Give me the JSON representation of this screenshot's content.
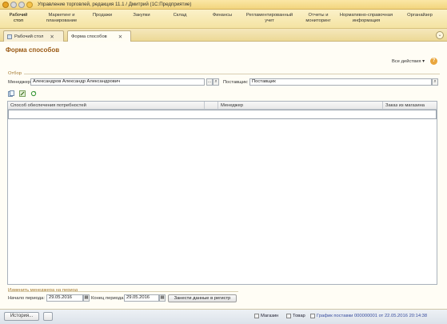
{
  "window": {
    "title": "Управление торговлей, редакция 11.1 / Дмитрий  (1С:Предприятие)"
  },
  "menu": [
    {
      "label": "Рабочий стол"
    },
    {
      "label": "Маркетинг и планирование"
    },
    {
      "label": "Продажи"
    },
    {
      "label": "Закупки"
    },
    {
      "label": "Склад"
    },
    {
      "label": "Финансы"
    },
    {
      "label": "Регламентированный учет"
    },
    {
      "label": "Отчеты и мониторинг"
    },
    {
      "label": "Нормативно-справочная информация"
    },
    {
      "label": "Органайзер"
    }
  ],
  "tabs": [
    {
      "label": "Рабочий стол"
    },
    {
      "label": "Форма способов"
    }
  ],
  "form": {
    "title": "Форма способов",
    "all_actions": "Все действия ▾",
    "help": "?",
    "filter_group": "Отбор",
    "manager_label": "Менеджер:",
    "manager_value": "Александров Александр Александрович",
    "supplier_label": "Поставщик:",
    "supplier_value": "Поставщик"
  },
  "grid": {
    "columns": [
      "Способ обеспечения потребностей",
      "Менеджер",
      "Заказ из магазина"
    ]
  },
  "period": {
    "group_label": "Изменить менеджера на период",
    "start_label": "Начало периода:",
    "start_value": "29.05.2016",
    "end_label": "Конец периода:",
    "end_value": "29.05.2016",
    "submit": "Занести данные в регистр"
  },
  "statusbar": {
    "history": "История...",
    "link_store": "Магазин",
    "link_goods": "Товар",
    "link_schedule": "График поставки 000000001 от 22.05.2016 20:14:38"
  },
  "icons": {
    "select": "…",
    "search": "🔍",
    "calendar": "calendar-icon",
    "close": "✕"
  }
}
